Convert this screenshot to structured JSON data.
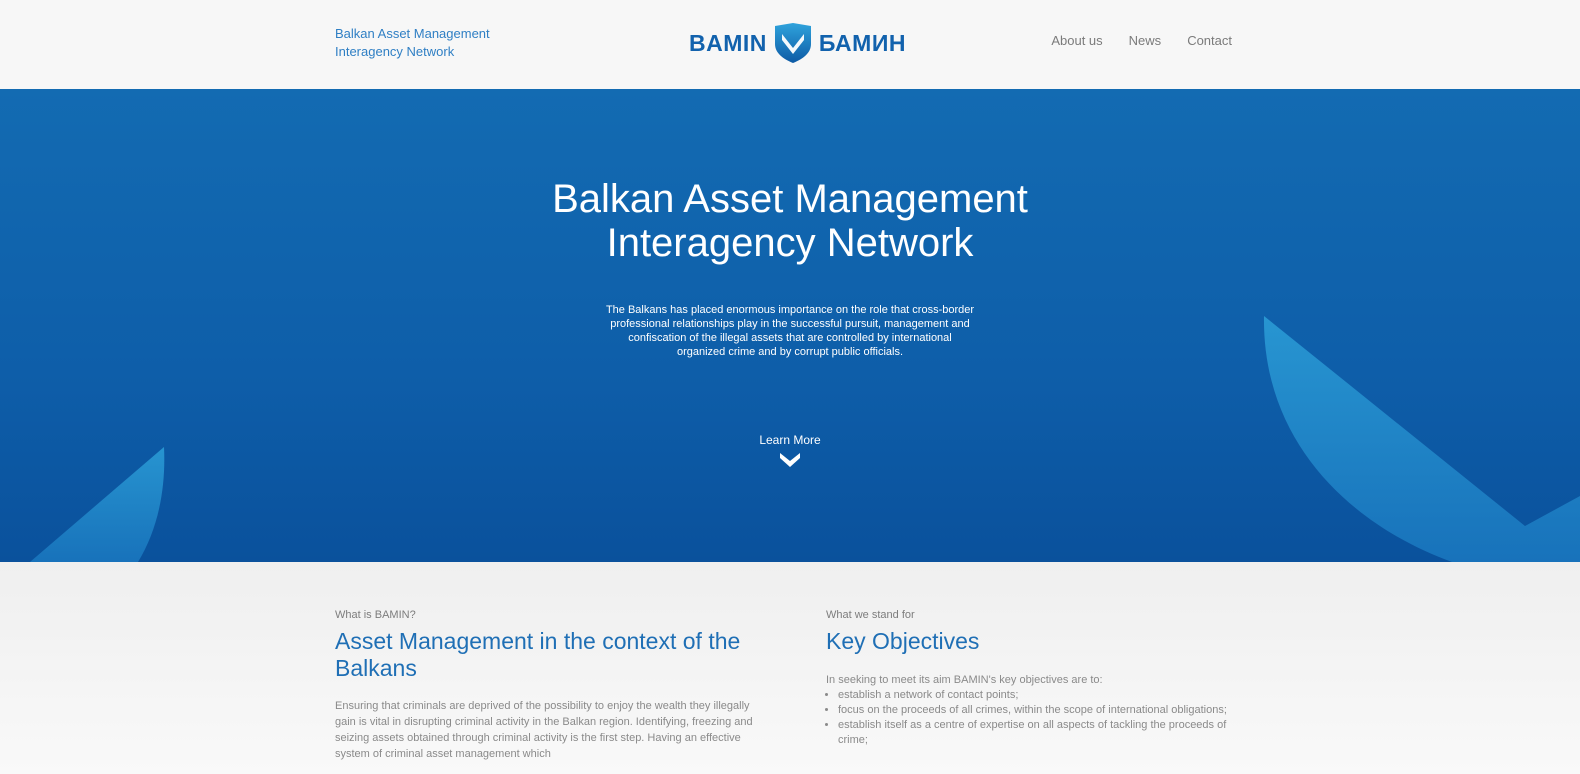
{
  "header": {
    "brand_line1": "Balkan Asset Management",
    "brand_line2": "Interagency Network",
    "logo_left": "BAMIN",
    "logo_right": "БАМИН",
    "logo_icon": "shield-check-icon",
    "nav": [
      {
        "label": "About us"
      },
      {
        "label": "News"
      },
      {
        "label": "Contact"
      }
    ]
  },
  "hero": {
    "title_line1": "Balkan Asset Management",
    "title_line2": "Interagency Network",
    "description": "The Balkans has placed enormous importance on the role that cross-border professional relationships play in the successful pursuit, management and confiscation of the illegal assets that are controlled by international organized crime and by corrupt public officials.",
    "learn_more_label": "Learn More",
    "learn_more_icon": "chevron-down-icon"
  },
  "sections": {
    "left": {
      "eyebrow": "What is BAMIN?",
      "title": "Asset Management in the context of the Balkans",
      "body": "Ensuring that criminals are deprived of the possibility to enjoy the wealth they illegally gain is vital in disrupting criminal activity in the Balkan region. Identifying, freezing and seizing assets obtained through criminal activity is the first step. Having an effective system of criminal asset management which"
    },
    "right": {
      "eyebrow": "What we stand for",
      "title": "Key Objectives",
      "intro": "In seeking to meet its aim BAMIN's key objectives are to:",
      "items": [
        "establish a network of contact points;",
        "focus on the proceeds of all crimes, within the scope of international obligations;",
        "establish itself as a centre of expertise on all aspects of tackling the proceeds of crime;"
      ]
    }
  },
  "colors": {
    "brand_blue": "#1262ad",
    "hero_top": "#136bb2",
    "hero_bottom": "#0a519c",
    "accent_light": "#2a9ad4",
    "title_blue": "#1f6fb5",
    "nav_gray": "#7b7b7b"
  }
}
